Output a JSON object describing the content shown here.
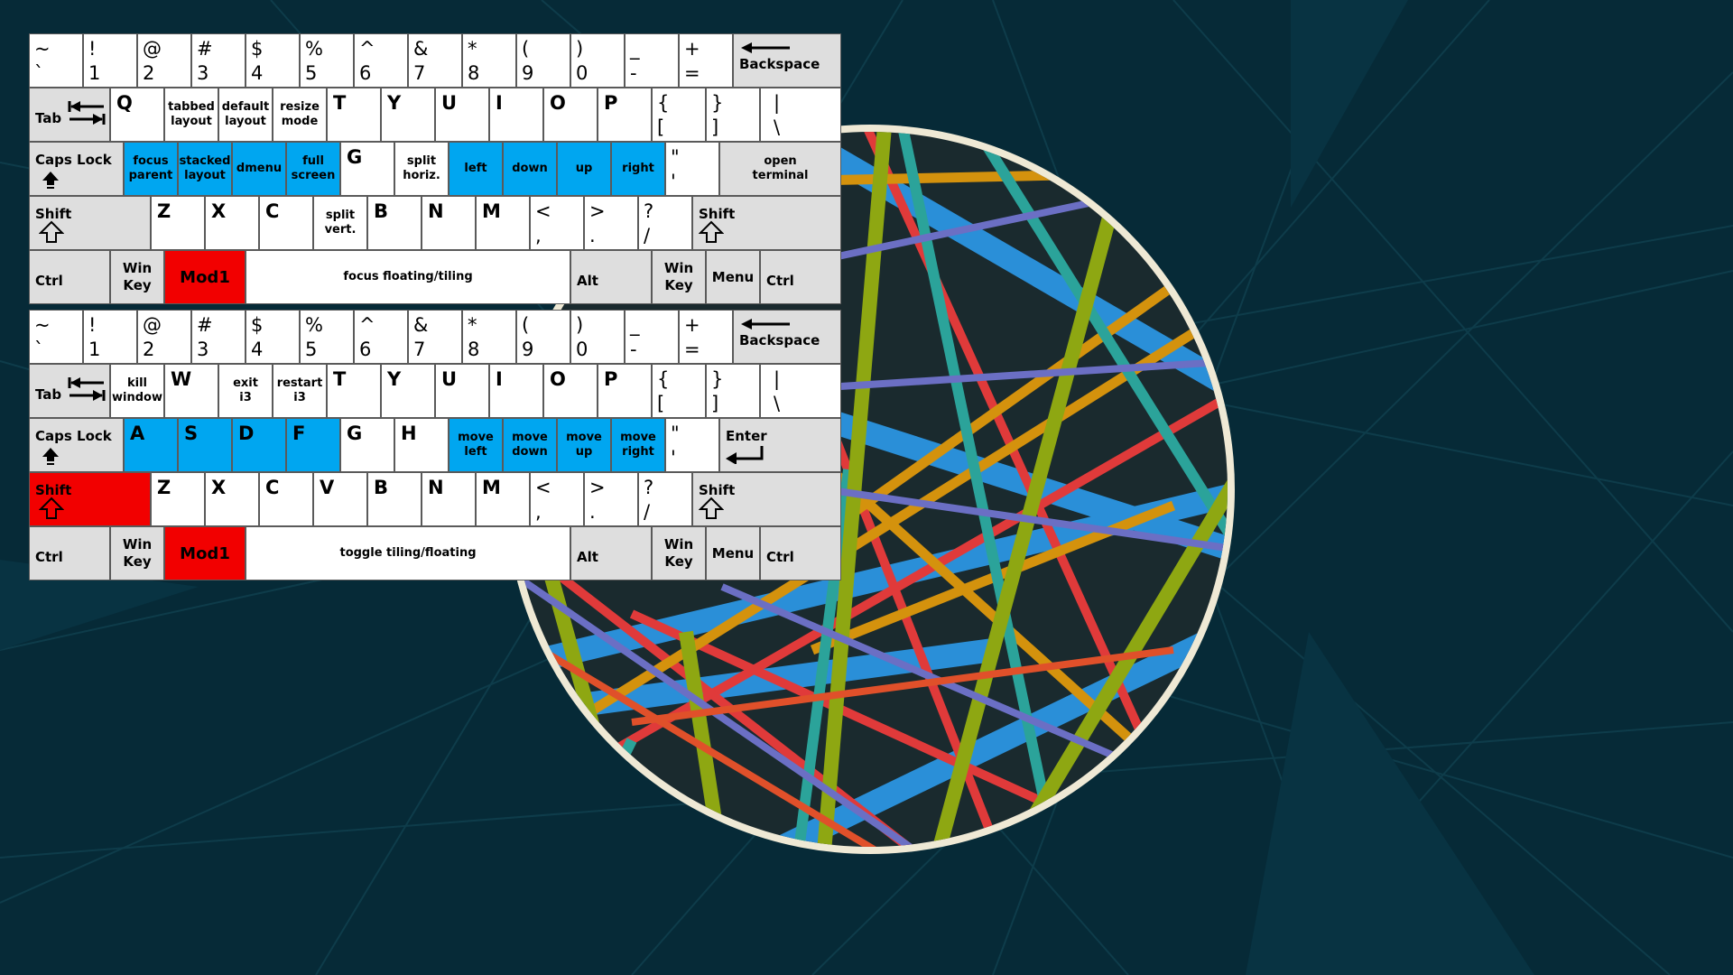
{
  "sym_keys": [
    {
      "top": "~",
      "bottom": "`"
    },
    {
      "top": "!",
      "bottom": "1"
    },
    {
      "top": "@",
      "bottom": "2"
    },
    {
      "top": "#",
      "bottom": "3"
    },
    {
      "top": "$",
      "bottom": "4"
    },
    {
      "top": "%",
      "bottom": "5"
    },
    {
      "top": "^",
      "bottom": "6"
    },
    {
      "top": "&",
      "bottom": "7"
    },
    {
      "top": "*",
      "bottom": "8"
    },
    {
      "top": "(",
      "bottom": "9"
    },
    {
      "top": ")",
      "bottom": "0"
    },
    {
      "top": "_",
      "bottom": "-"
    },
    {
      "top": "+",
      "bottom": "="
    }
  ],
  "common": {
    "backspace": "Backspace",
    "tab": "Tab",
    "caps": "Caps Lock",
    "shift": "Shift",
    "ctrl": "Ctrl",
    "win_key": "Win\nKey",
    "mod1": "Mod1",
    "alt": "Alt",
    "menu": "Menu",
    "enter": "Enter",
    "letters": {
      "Q": "Q",
      "W": "W",
      "T": "T",
      "Y": "Y",
      "U": "U",
      "I": "I",
      "O": "O",
      "P": "P",
      "A": "A",
      "S": "S",
      "D": "D",
      "F": "F",
      "G": "G",
      "H": "H",
      "Z": "Z",
      "X": "X",
      "C": "C",
      "V": "V",
      "B": "B",
      "N": "N",
      "M": "M"
    },
    "brackets": {
      "lb_t": "{",
      "lb_b": "[",
      "rb_t": "}",
      "rb_b": "]",
      "pipe_t": "|",
      "pipe_b": "\\",
      "quote_t": "\"",
      "quote_b": "'",
      "lt_t": "<",
      "lt_b": ",",
      "gt_t": ">",
      "gt_b": ".",
      "q_t": "?",
      "q_b": "/"
    }
  },
  "kb1": {
    "tabbed_layout": "tabbed\nlayout",
    "default_layout": "default\nlayout",
    "resize_mode": "resize\nmode",
    "focus_parent": "focus\nparent",
    "stacked_layout": "stacked\nlayout",
    "dmenu": "dmenu",
    "full_screen": "full\nscreen",
    "split_horiz": "split\nhoriz.",
    "left": "left",
    "down": "down",
    "up": "up",
    "right": "right",
    "open_terminal": "open\nterminal",
    "split_vert": "split\nvert.",
    "space": "focus floating/tiling"
  },
  "kb2": {
    "kill_window": "kill\nwindow",
    "exit_i3": "exit\ni3",
    "restart_i3": "restart\ni3",
    "move_left": "move\nleft",
    "move_down": "move\ndown",
    "move_up": "move\nup",
    "move_right": "move\nright",
    "space": "toggle tiling/floating"
  },
  "colors": {
    "background": "#062a37",
    "highlight_blue": "#00a6f0",
    "highlight_red": "#f20000",
    "modifier_gray": "#dedede",
    "logo_ring": "#efe9d5"
  }
}
